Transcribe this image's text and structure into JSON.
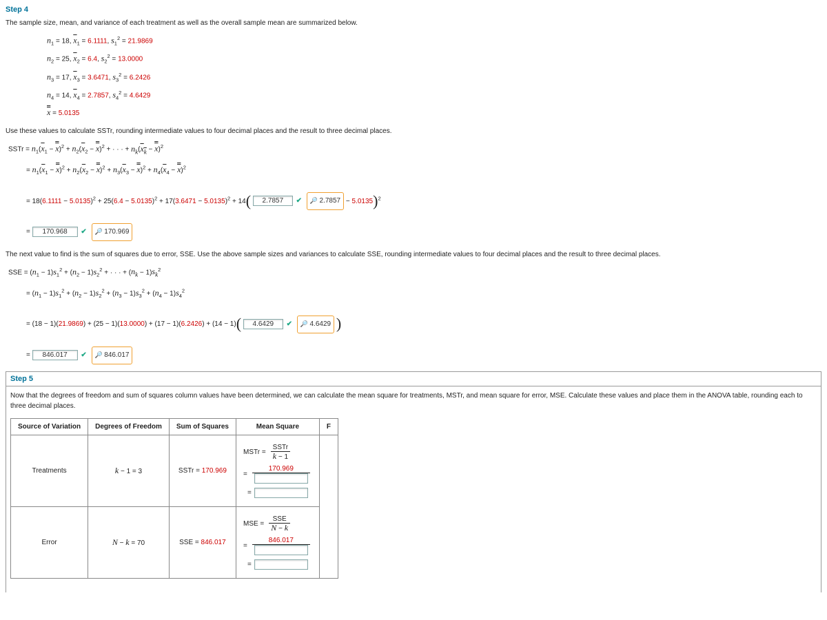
{
  "step4": {
    "title": "Step 4",
    "intro": "The sample size, mean, and variance of each treatment as well as the overall sample mean are summarized below.",
    "g1": {
      "n": "18",
      "mean": "6.1111",
      "var": "21.9869"
    },
    "g2": {
      "n": "25",
      "mean": "6.4",
      "var": "13.0000"
    },
    "g3": {
      "n": "17",
      "mean": "3.6471",
      "var": "6.2426"
    },
    "g4": {
      "n": "14",
      "mean": "2.7857",
      "var": "4.6429"
    },
    "grand": "5.0135",
    "sstr_text": "Use these values to calculate SSTr, rounding intermediate values to four decimal places and the result to three decimal places.",
    "sstr_ans1": "2.7857",
    "sstr_hint1": "2.7857",
    "sstr_const": "5.0135",
    "sstr_result": "170.968",
    "sstr_result_hint": "170.969",
    "sse_text": "The next value to find is the sum of squares due to error, SSE. Use the above sample sizes and variances to calculate SSE, rounding intermediate values to four decimal places and the result to three decimal places.",
    "sse_ans1": "4.6429",
    "sse_hint1": "4.6429",
    "sse_result": "846.017",
    "sse_result_hint": "846.017"
  },
  "step5": {
    "title": "Step 5",
    "intro": "Now that the degrees of freedom and sum of squares column values have been determined, we can calculate the mean square for treatments, MSTr, and mean square for error, MSE. Calculate these values and place them in the ANOVA table, rounding each to three decimal places.",
    "headers": {
      "src": "Source of Variation",
      "df": "Degrees of Freedom",
      "ss": "Sum of Squares",
      "ms": "Mean Square",
      "f": "F"
    },
    "row1": {
      "src": "Treatments",
      "df": "k − 1 = 3",
      "ss": "SSTr = 170.969",
      "ms_num": "170.969"
    },
    "row2": {
      "src": "Error",
      "df": "N − k = 70",
      "ss": "SSE = 846.017",
      "ms_num": "846.017"
    }
  }
}
